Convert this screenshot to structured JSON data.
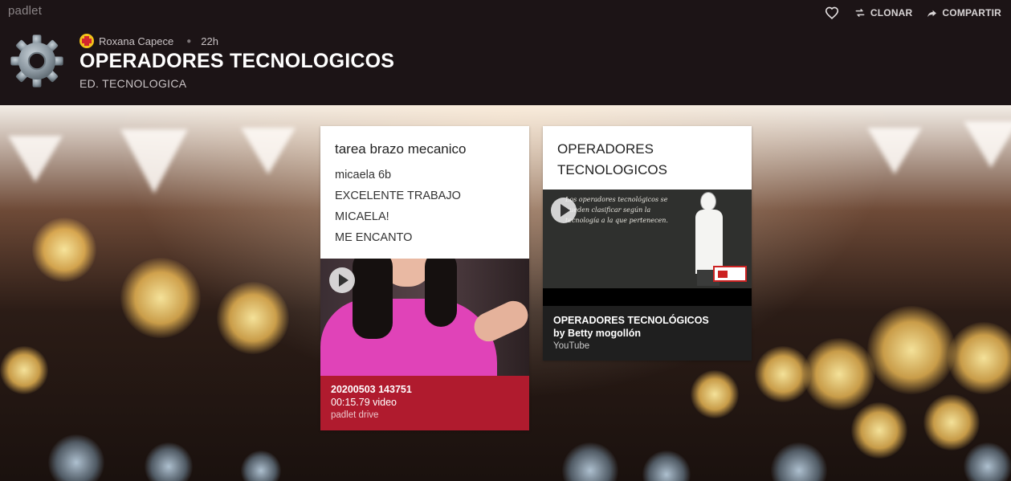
{
  "app": {
    "brand": "padlet"
  },
  "top_actions": {
    "clone_label": "CLONAR",
    "share_label": "COMPARTIR"
  },
  "header": {
    "author": "Roxana Capece",
    "time_ago": "22h",
    "title": "OPERADORES TECNOLOGICOS",
    "subtitle": "ED. TECNOLOGICA"
  },
  "posts": [
    {
      "title": "tarea brazo mecanico",
      "body_lines": [
        "micaela 6b",
        "EXCELENTE TRABAJO",
        "MICAELA!",
        "ME ENCANTO"
      ],
      "attachment": {
        "title": "20200503 143751",
        "subtitle": "00:15.79 video",
        "source": "padlet drive",
        "color": "#b01b2e"
      }
    },
    {
      "title": "OPERADORES TECNOLOGICOS",
      "media_text": "Los operadores tecnológicos se pueden clasificar según la tecnología a la que pertenecen.",
      "attachment": {
        "title": "OPERADORES TECNOLÓGICOS",
        "subtitle": "by Betty mogollón",
        "source": "YouTube",
        "color": "#1f1f1f"
      }
    }
  ],
  "icons": {
    "heart": "heart-icon",
    "clone": "clone-icon",
    "share": "share-icon",
    "logo": "gear-icon",
    "play": "play-icon"
  }
}
